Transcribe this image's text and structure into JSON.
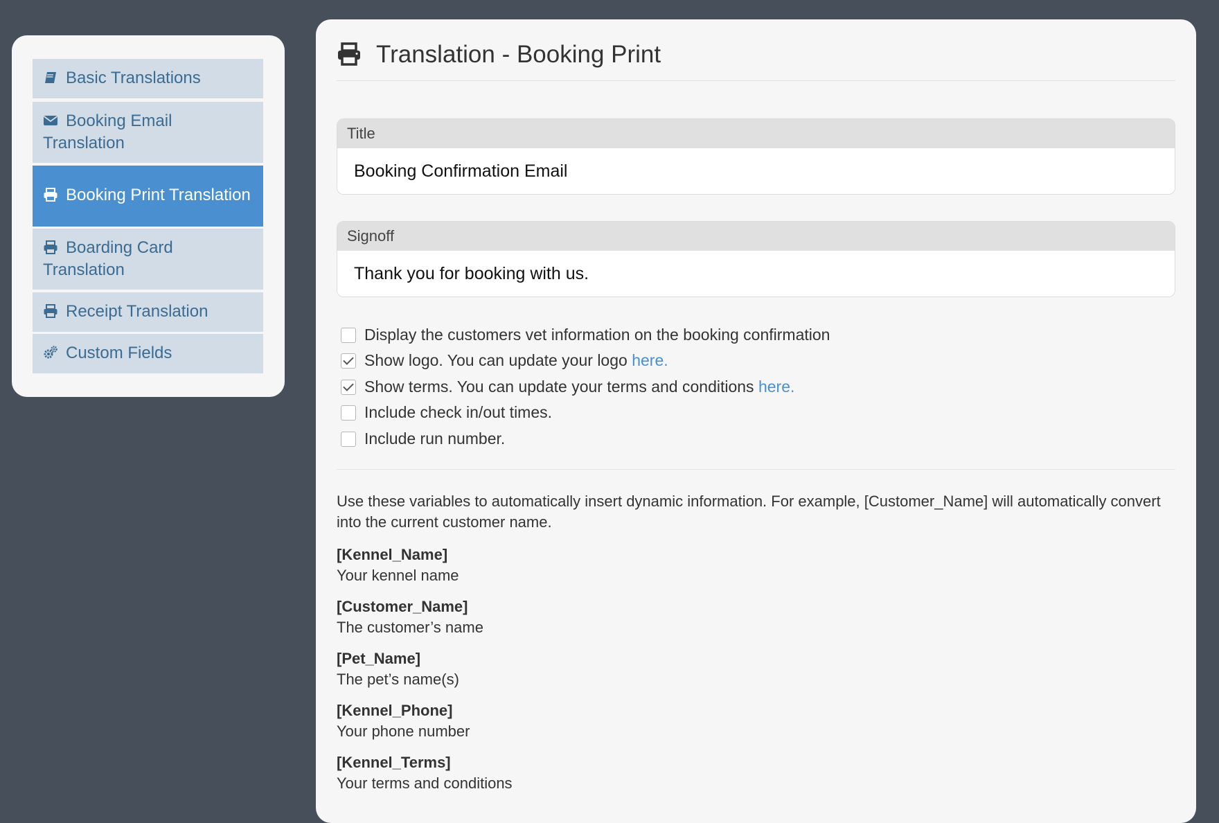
{
  "sidebar": {
    "items": [
      {
        "label": "Basic Translations",
        "icon": "book-icon",
        "active": false
      },
      {
        "label": "Booking Email",
        "label2": "Translation",
        "icon": "envelope-icon",
        "active": false
      },
      {
        "label": "Booking Print Translation",
        "icon": "print-icon",
        "active": true
      },
      {
        "label": "Boarding Card",
        "label2": "Translation",
        "icon": "print-icon",
        "active": false
      },
      {
        "label": "Receipt Translation",
        "icon": "print-icon",
        "active": false
      },
      {
        "label": "Custom Fields",
        "icon": "cogs-icon",
        "active": false
      }
    ]
  },
  "page": {
    "title": "Translation - Booking Print",
    "icon": "print-icon"
  },
  "fields": {
    "title": {
      "label": "Title",
      "value": "Booking Confirmation Email"
    },
    "signoff": {
      "label": "Signoff",
      "value": "Thank you for booking with us."
    }
  },
  "options": [
    {
      "text": "Display the customers vet information on the booking confirmation",
      "checked": false
    },
    {
      "text": "Show logo. You can update your logo ",
      "link": "here.",
      "checked": true
    },
    {
      "text": "Show terms. You can update your terms and conditions ",
      "link": "here.",
      "checked": true
    },
    {
      "text": "Include check in/out times.",
      "checked": false
    },
    {
      "text": "Include run number.",
      "checked": false
    }
  ],
  "help_text": "Use these variables to automatically insert dynamic information. For example, [Customer_Name] will automatically convert into the current customer name.",
  "variables": [
    {
      "name": "[Kennel_Name]",
      "desc": "Your kennel name"
    },
    {
      "name": "[Customer_Name]",
      "desc": "The customer’s name"
    },
    {
      "name": "[Pet_Name]",
      "desc": "The pet’s name(s)"
    },
    {
      "name": "[Kennel_Phone]",
      "desc": "Your phone number"
    },
    {
      "name": "[Kennel_Terms]",
      "desc": "Your terms and conditions"
    }
  ],
  "colors": {
    "background": "#474f5b",
    "panel": "#f6f6f6",
    "nav_item": "#d1dce6",
    "nav_active": "#4a8fcf",
    "nav_text": "#3c6b92",
    "link": "#4a8fcf"
  }
}
